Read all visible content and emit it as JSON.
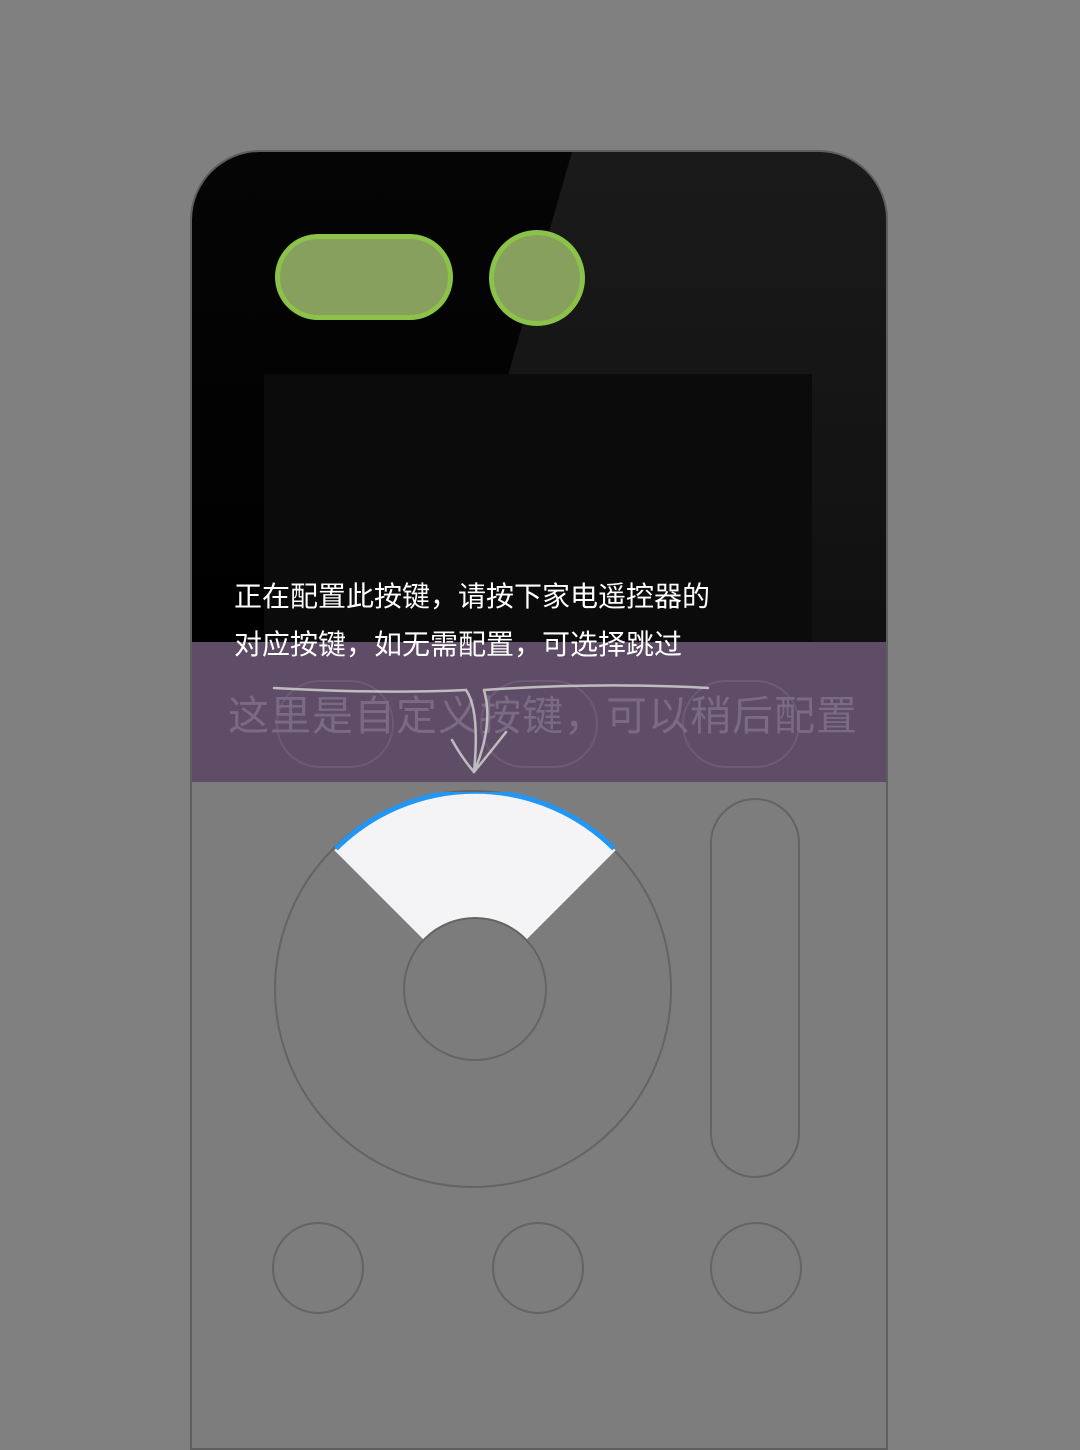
{
  "instruction": {
    "line1": "正在配置此按键，请按下家电遥控器的",
    "line2": "对应按键，如无需配置，可选择跳过"
  },
  "custom_area": {
    "hint": "这里是自定义按键，可以稍后配置"
  },
  "colors": {
    "background": "#808080",
    "remote_top": "#000000",
    "highlight_green": "#8bc34a",
    "custom_band": "#5f4c67",
    "selected_arc": "#2196f3",
    "selected_segment": "#f4f4f6"
  },
  "icons": {
    "arrow": "hand-drawn-down-arrow"
  }
}
